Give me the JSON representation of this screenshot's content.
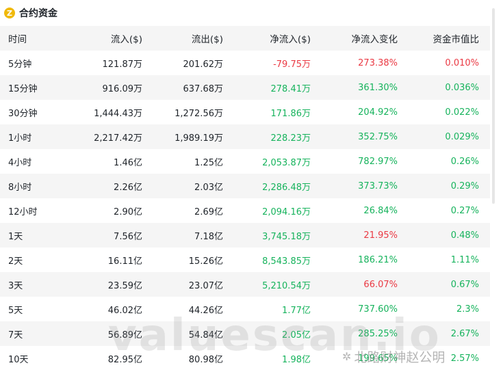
{
  "header": {
    "title": "合约资金",
    "logo_letter": "Z"
  },
  "columns": [
    "时间",
    "流入($)",
    "流出($)",
    "净流入($)",
    "净流入变化",
    "资金市值比"
  ],
  "rows": [
    {
      "period": "5分钟",
      "inflow": "121.87万",
      "outflow": "201.62万",
      "net": "-79.75万",
      "net_status": "neg",
      "change": "273.38%",
      "change_status": "neg",
      "ratio": "0.010%",
      "ratio_status": "neg"
    },
    {
      "period": "15分钟",
      "inflow": "916.09万",
      "outflow": "637.68万",
      "net": "278.41万",
      "net_status": "pos",
      "change": "361.30%",
      "change_status": "pos",
      "ratio": "0.036%",
      "ratio_status": "pos"
    },
    {
      "period": "30分钟",
      "inflow": "1,444.43万",
      "outflow": "1,272.56万",
      "net": "171.86万",
      "net_status": "pos",
      "change": "204.92%",
      "change_status": "pos",
      "ratio": "0.022%",
      "ratio_status": "pos"
    },
    {
      "period": "1小时",
      "inflow": "2,217.42万",
      "outflow": "1,989.19万",
      "net": "228.23万",
      "net_status": "pos",
      "change": "352.75%",
      "change_status": "pos",
      "ratio": "0.029%",
      "ratio_status": "pos"
    },
    {
      "period": "4小时",
      "inflow": "1.46亿",
      "outflow": "1.25亿",
      "net": "2,053.87万",
      "net_status": "pos",
      "change": "782.97%",
      "change_status": "pos",
      "ratio": "0.26%",
      "ratio_status": "pos"
    },
    {
      "period": "8小时",
      "inflow": "2.26亿",
      "outflow": "2.03亿",
      "net": "2,286.48万",
      "net_status": "pos",
      "change": "373.73%",
      "change_status": "pos",
      "ratio": "0.29%",
      "ratio_status": "pos"
    },
    {
      "period": "12小时",
      "inflow": "2.90亿",
      "outflow": "2.69亿",
      "net": "2,094.16万",
      "net_status": "pos",
      "change": "26.84%",
      "change_status": "pos",
      "ratio": "0.27%",
      "ratio_status": "pos"
    },
    {
      "period": "1天",
      "inflow": "7.56亿",
      "outflow": "7.18亿",
      "net": "3,745.18万",
      "net_status": "pos",
      "change": "21.95%",
      "change_status": "neg",
      "ratio": "0.48%",
      "ratio_status": "pos"
    },
    {
      "period": "2天",
      "inflow": "16.11亿",
      "outflow": "15.26亿",
      "net": "8,543.85万",
      "net_status": "pos",
      "change": "186.21%",
      "change_status": "pos",
      "ratio": "1.11%",
      "ratio_status": "pos"
    },
    {
      "period": "3天",
      "inflow": "23.59亿",
      "outflow": "23.07亿",
      "net": "5,210.54万",
      "net_status": "pos",
      "change": "66.07%",
      "change_status": "neg",
      "ratio": "0.67%",
      "ratio_status": "pos"
    },
    {
      "period": "5天",
      "inflow": "46.02亿",
      "outflow": "44.26亿",
      "net": "1.77亿",
      "net_status": "pos",
      "change": "737.60%",
      "change_status": "pos",
      "ratio": "2.3%",
      "ratio_status": "pos"
    },
    {
      "period": "7天",
      "inflow": "56.89亿",
      "outflow": "54.84亿",
      "net": "2.05亿",
      "net_status": "pos",
      "change": "285.25%",
      "change_status": "pos",
      "ratio": "2.67%",
      "ratio_status": "pos"
    },
    {
      "period": "10天",
      "inflow": "82.95亿",
      "outflow": "80.98亿",
      "net": "1.98亿",
      "net_status": "pos",
      "change": "199.65%",
      "change_status": "pos",
      "ratio": "2.57%",
      "ratio_status": "pos"
    }
  ],
  "colors": {
    "pos": "#16b35c",
    "neg": "#ea3943",
    "accent": "#f0b90b",
    "stripe": "#f5f5f5"
  },
  "watermark": {
    "text": "valuescan.io",
    "credit": "北路财神赵公明",
    "credit_icon": "wechat-icon"
  }
}
